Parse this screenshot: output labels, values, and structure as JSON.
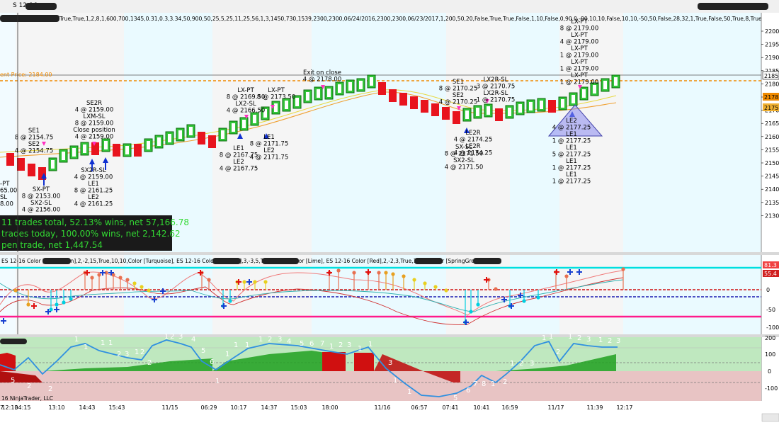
{
  "window": {
    "instrument_short": "S 12-16",
    "param_string": "True,True,1,2,8,1,600,700,1345,0.31,0.3,3.34,50,900,50,25,5,25,11,25,56,1,3,1450,730,1539,2300,2300,06/24/2016,2300,2300,06/23/2017,1,200,50,20,False,True,True,False,1,10,False,0,90,0,-90,10,10,False,10,10,-50,50,False,28,32,1,True,False,50,True,8,True,10,-5,2,3)"
  },
  "price_panel": {
    "axis_ticks": [
      "2200",
      "2195",
      "2190",
      "2185",
      "2180",
      "2175",
      "2170",
      "2165",
      "2160",
      "2155",
      "2150",
      "2145",
      "2140",
      "2135",
      "2130"
    ],
    "current_price_label": "ent Price: 2184.00",
    "right_badges": [
      "2185",
      "2178",
      "2175"
    ],
    "summary": [
      "11 trades total, 52.13% wins, net 57,166.78",
      "trades today, 100.00% wins, net 2,142.62",
      "pen trade, net 1,447.54"
    ],
    "annotations": {
      "left_cut": [
        "-PT",
        "65.00",
        "SL",
        "8.00"
      ],
      "se1_group": [
        "SE1",
        "8 @ 2154.75",
        "SE2",
        "4 @ 2154.75"
      ],
      "sxpt_group": [
        "SX-PT",
        "8 @ 2153.00",
        "SX2-SL",
        "4 @ 2156.00"
      ],
      "se2r_group": [
        "SE2R",
        "4 @ 2159.00",
        "LXM-SL",
        "8 @ 2159.00",
        "Close position",
        "4 @ 2159.00"
      ],
      "le1_group_a": [
        "SX2R-SL",
        "4 @ 2159.00",
        "LE1",
        "8 @ 2161.25",
        "LE2",
        "4 @ 2161.25"
      ],
      "lxpt_group_a": [
        "LX-PT",
        "8 @ 2169.50",
        "LX2-SL",
        "4 @ 2166.50"
      ],
      "lxpt_group_b": [
        "LX-PT",
        "8 @ 2173.50"
      ],
      "le1_group_b": [
        "LE1",
        "8 @ 2167.75",
        "LE2",
        "4 @ 2167.75"
      ],
      "le1_group_c": [
        "LE1",
        "8 @ 2171.75",
        "LE2",
        "4 @ 2171.75"
      ],
      "exit_close": [
        "Exit on close",
        "4 @ 2178.00"
      ],
      "se1_group_b": [
        "SE1",
        "8 @ 2170.25",
        "SE2",
        "4 @ 2170.25"
      ],
      "lx2r_group": [
        "LX2R-SL",
        "3 @ 2170.75",
        "LX2R-SL",
        "1 @ 2170.75"
      ],
      "le2r_group": [
        "LE2R",
        "4 @ 2174.25",
        "LE2R",
        "4 @ 2174.25"
      ],
      "sx_group_c": [
        "SX-SL",
        "8 @ 2171.50",
        "SX2-SL",
        "4 @ 2171.50"
      ],
      "lxpt_stack": [
        "LX-PT",
        "8 @ 2179.00",
        "LX-PT",
        "4 @ 2179.00",
        "LX-PT",
        "1 @ 2179.00",
        "LX-PT",
        "1 @ 2179.00",
        "LX-PT",
        "1 @ 2179.00"
      ],
      "le_stack": [
        "LE2",
        "4 @ 2177.25",
        "LE1",
        "1 @ 2177.25",
        "LE1",
        "5 @ 2177.25",
        "LE1",
        "1 @ 2177.25",
        "LE1",
        "1 @ 2177.25"
      ]
    }
  },
  "indicator_panel_1": {
    "header": "ES  12-16          Color  [RosyBrown],2,-2,15,True,10,10,Color  [Turquoise],              ES  12-16          Color  [Salmon],3,-3,5,True,10,10,Color  [Lime],            ES  12-16          Color  [Red],2,-2,3,True,10,10,Color  [SpringGreen])",
    "axis_ticks": [
      "50",
      "0",
      "-50",
      "-100"
    ],
    "right_badges": [
      "81.3",
      "55.4"
    ]
  },
  "indicator_panel_2": {
    "axis_ticks": [
      "200",
      "100",
      "0",
      "-100"
    ]
  },
  "time_axis": {
    "copyright": "16 NinjaTrader, LLC",
    "labels": [
      "7",
      "12:10",
      "34:15",
      "13:10",
      "14:43",
      "15:43",
      "11/15",
      "06:29",
      "10:17",
      "14:37",
      "15:03",
      "18:00",
      "11/16",
      "06:57",
      "07:41",
      "10:41",
      "16:59",
      "11/17",
      "11:39",
      "12:17"
    ]
  },
  "colors": {
    "bull_bar": "#33c43a",
    "bear_bar": "#e8141e",
    "session_band": "#eafaff",
    "orange_dash": "#f08a00",
    "cyan_line": "#00dfe0",
    "magenta_line": "#ff1a8c",
    "blue_line": "#2a6be0"
  }
}
